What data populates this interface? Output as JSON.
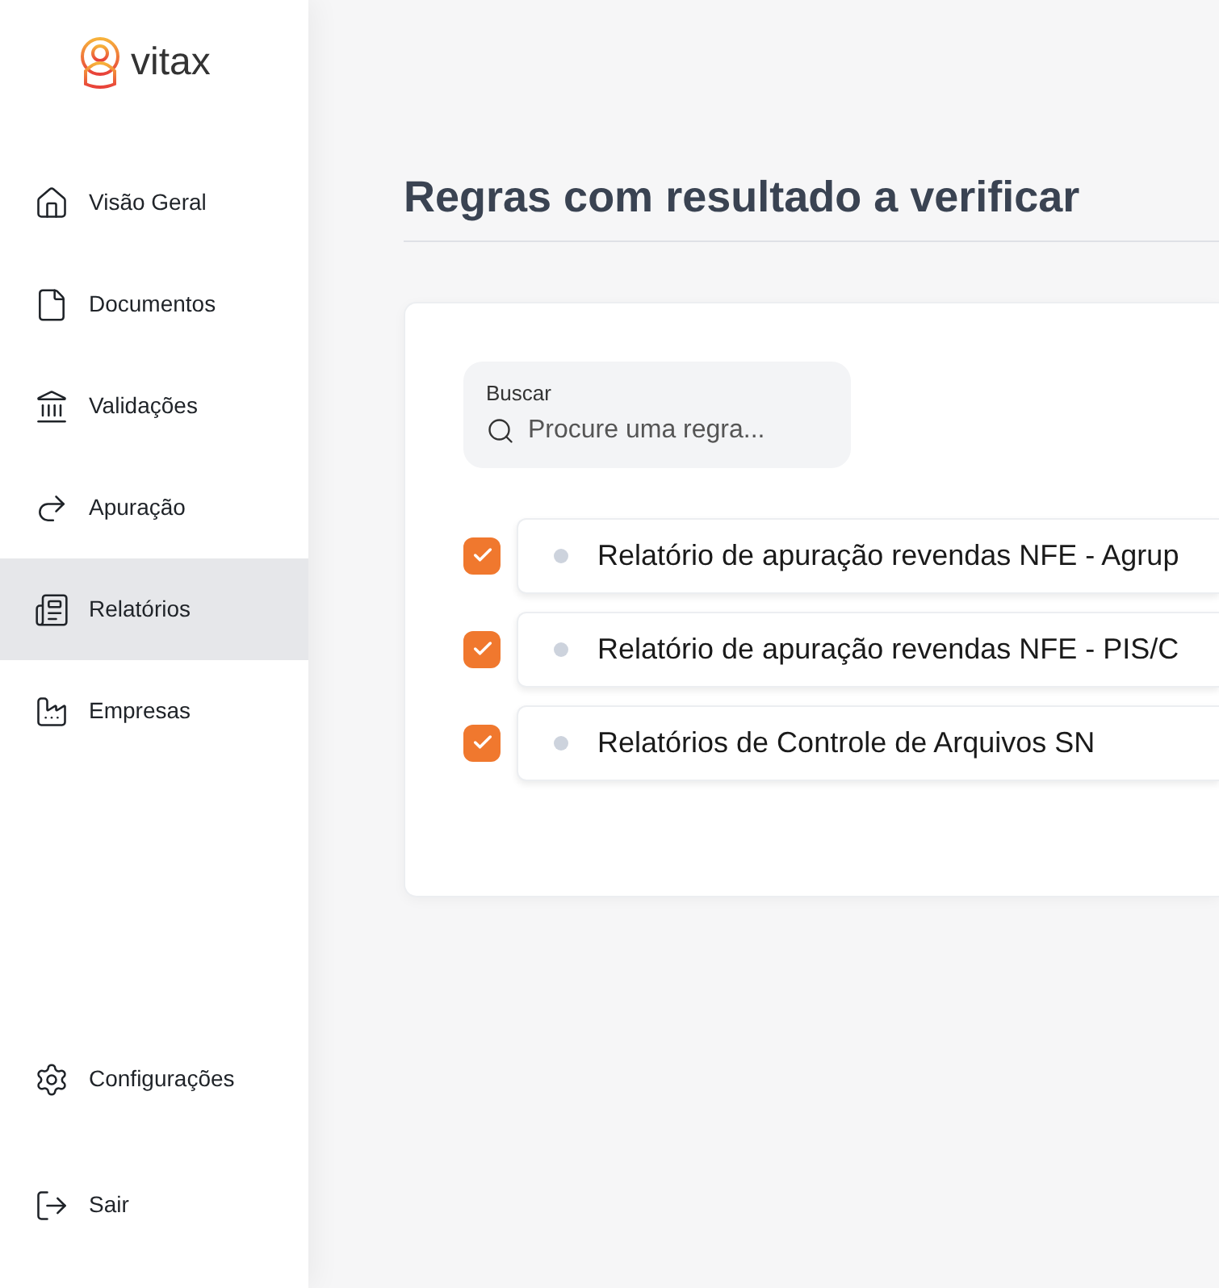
{
  "logo": {
    "text": "vitax"
  },
  "sidebar": {
    "items": [
      {
        "label": "Visão Geral",
        "selected": false
      },
      {
        "label": "Documentos",
        "selected": false
      },
      {
        "label": "Validações",
        "selected": false
      },
      {
        "label": "Apuração",
        "selected": false
      },
      {
        "label": "Relatórios",
        "selected": true
      },
      {
        "label": "Empresas",
        "selected": false
      }
    ],
    "bottom_items": [
      {
        "label": "Configurações",
        "selected": false
      },
      {
        "label": "Sair",
        "selected": false
      }
    ]
  },
  "page": {
    "title": "Regras com resultado a verificar"
  },
  "search": {
    "label": "Buscar",
    "placeholder": "Procure uma regra..."
  },
  "rules": [
    {
      "label": "Relatório de apuração revendas NFE - Agrup",
      "checked": true
    },
    {
      "label": "Relatório de apuração revendas NFE - PIS/C",
      "checked": true
    },
    {
      "label": "Relatórios de Controle de Arquivos SN",
      "checked": true
    }
  ]
}
